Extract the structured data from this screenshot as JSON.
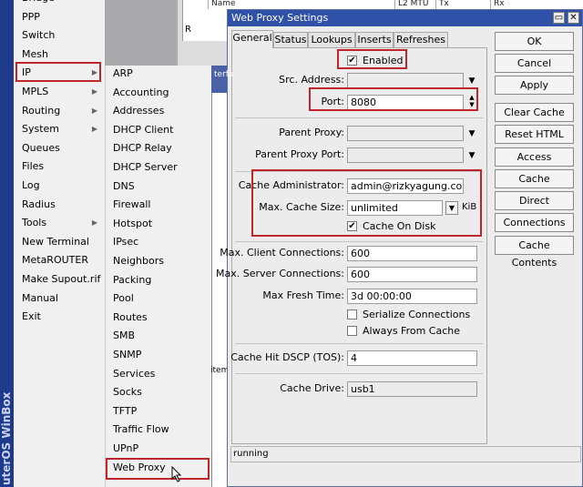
{
  "app_vertical_label": "uterOS WinBox",
  "main_menu": [
    {
      "label": "Bridge",
      "arrow": false
    },
    {
      "label": "PPP",
      "arrow": false
    },
    {
      "label": "Switch",
      "arrow": false
    },
    {
      "label": "Mesh",
      "arrow": false
    },
    {
      "label": "IP",
      "arrow": true
    },
    {
      "label": "MPLS",
      "arrow": true
    },
    {
      "label": "Routing",
      "arrow": true
    },
    {
      "label": "System",
      "arrow": true
    },
    {
      "label": "Queues",
      "arrow": false
    },
    {
      "label": "Files",
      "arrow": false
    },
    {
      "label": "Log",
      "arrow": false
    },
    {
      "label": "Radius",
      "arrow": false
    },
    {
      "label": "Tools",
      "arrow": true
    },
    {
      "label": "New Terminal",
      "arrow": false
    },
    {
      "label": "MetaROUTER",
      "arrow": false
    },
    {
      "label": "Make Supout.rif",
      "arrow": false
    },
    {
      "label": "Manual",
      "arrow": false
    },
    {
      "label": "Exit",
      "arrow": false
    }
  ],
  "ip_submenu": [
    "ARP",
    "Accounting",
    "Addresses",
    "DHCP Client",
    "DHCP Relay",
    "DHCP Server",
    "DNS",
    "Firewall",
    "Hotspot",
    "IPsec",
    "Neighbors",
    "Packing",
    "Pool",
    "Routes",
    "SMB",
    "SNMP",
    "Services",
    "Socks",
    "TFTP",
    "Traffic Flow",
    "UPnP",
    "Web Proxy"
  ],
  "background_window": {
    "headers": [
      "Name",
      "L2 MTU",
      "Tx",
      "Rx"
    ],
    "row_flag": "R",
    "partial_tab": "terfa",
    "partial_label": "items"
  },
  "dialog": {
    "title": "Web Proxy Settings",
    "tabs": [
      "General",
      "Status",
      "Lookups",
      "Inserts",
      "Refreshes"
    ],
    "enabled_label": "Enabled",
    "fields": {
      "src_address": {
        "label": "Src. Address:",
        "value": ""
      },
      "port": {
        "label": "Port:",
        "value": "8080"
      },
      "parent_proxy": {
        "label": "Parent Proxy:",
        "value": ""
      },
      "parent_proxy_port": {
        "label": "Parent Proxy Port:",
        "value": ""
      },
      "cache_admin": {
        "label": "Cache Administrator:",
        "value": "admin@rizkyagung.com"
      },
      "max_cache_size": {
        "label": "Max. Cache Size:",
        "value": "unlimited",
        "unit": "KiB"
      },
      "cache_on_disk": {
        "label": "Cache On Disk",
        "checked": true
      },
      "max_client_conn": {
        "label": "Max. Client Connections:",
        "value": "600"
      },
      "max_server_conn": {
        "label": "Max. Server Connections:",
        "value": "600"
      },
      "max_fresh_time": {
        "label": "Max Fresh Time:",
        "value": "3d 00:00:00"
      },
      "serialize": {
        "label": "Serialize Connections",
        "checked": false
      },
      "always_from_cache": {
        "label": "Always From Cache",
        "checked": false
      },
      "cache_hit_dscp": {
        "label": "Cache Hit DSCP (TOS):",
        "value": "4"
      },
      "cache_drive": {
        "label": "Cache Drive:",
        "value": "usb1"
      }
    },
    "buttons": [
      "OK",
      "Cancel",
      "Apply",
      "Clear Cache",
      "Reset HTML",
      "Access",
      "Cache",
      "Direct",
      "Connections",
      "Cache Contents"
    ],
    "status": "running"
  },
  "colors": {
    "title_bar": "#2f51a7",
    "highlight_box": "#c0252b",
    "winbox_stripe": "#1d3a8c"
  },
  "icons": {
    "check": "✔",
    "dropdown": "▼",
    "spinner": "▲▼",
    "submenu_arrow": "▶"
  }
}
